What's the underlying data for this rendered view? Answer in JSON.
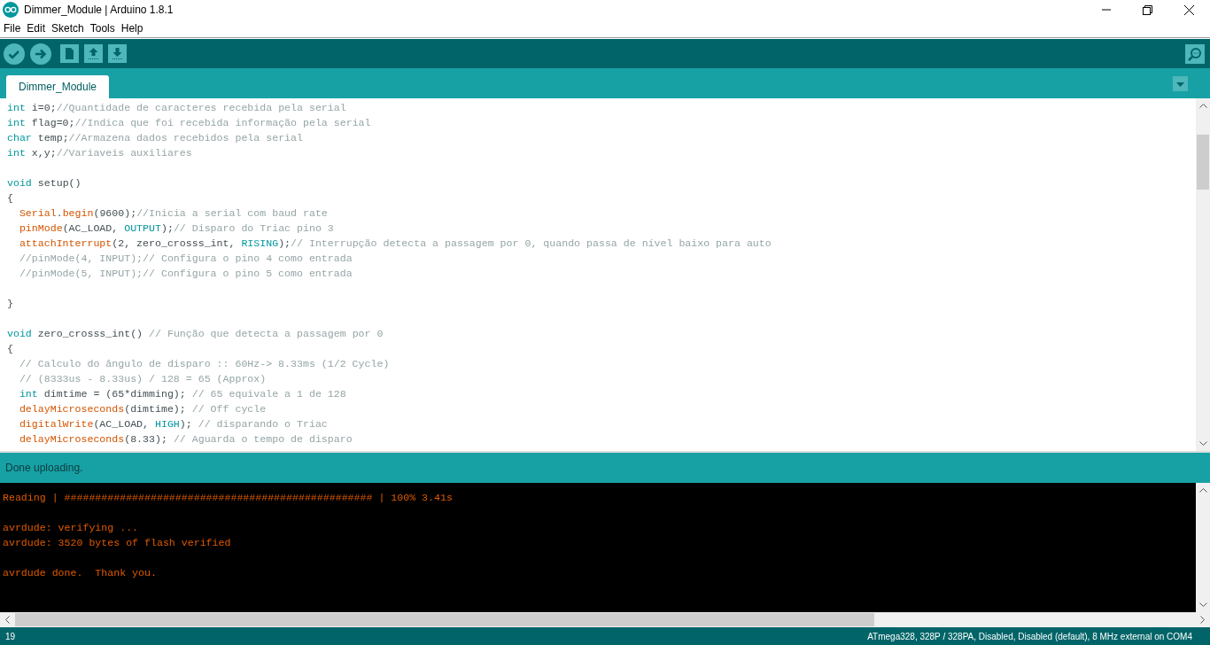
{
  "window": {
    "title": "Dimmer_Module | Arduino 1.8.1"
  },
  "menu": [
    {
      "label": "File"
    },
    {
      "label": "Edit"
    },
    {
      "label": "Sketch"
    },
    {
      "label": "Tools"
    },
    {
      "label": "Help"
    }
  ],
  "tabs": [
    {
      "label": "Dimmer_Module",
      "selected": true
    }
  ],
  "editor": {
    "lines": [
      {
        "kind": "code",
        "tokens": [
          {
            "kind": "keyword",
            "text": "int"
          },
          {
            "kind": "plain",
            "text": " i=0;"
          },
          {
            "kind": "comment",
            "text": "//Quantidade de caracteres recebida pela serial"
          }
        ]
      },
      {
        "kind": "code",
        "tokens": [
          {
            "kind": "keyword",
            "text": "int"
          },
          {
            "kind": "plain",
            "text": " flag=0;"
          },
          {
            "kind": "comment",
            "text": "//Indica que foi recebida informação pela serial"
          }
        ]
      },
      {
        "kind": "code",
        "tokens": [
          {
            "kind": "keyword",
            "text": "char"
          },
          {
            "kind": "plain",
            "text": " temp;"
          },
          {
            "kind": "comment",
            "text": "//Armazena dados recebidos pela serial"
          }
        ]
      },
      {
        "kind": "code",
        "tokens": [
          {
            "kind": "keyword",
            "text": "int"
          },
          {
            "kind": "plain",
            "text": " x,y;"
          },
          {
            "kind": "comment",
            "text": "//Variaveis auxiliares"
          }
        ]
      },
      {
        "kind": "blank"
      },
      {
        "kind": "code",
        "tokens": [
          {
            "kind": "keyword",
            "text": "void"
          },
          {
            "kind": "plain",
            "text": " setup()"
          }
        ]
      },
      {
        "kind": "code",
        "tokens": [
          {
            "kind": "plain",
            "text": "{"
          }
        ]
      },
      {
        "kind": "code",
        "tokens": [
          {
            "kind": "function",
            "text": "  Serial"
          },
          {
            "kind": "plain",
            "text": "."
          },
          {
            "kind": "function",
            "text": "begin"
          },
          {
            "kind": "plain",
            "text": "(9600);"
          },
          {
            "kind": "comment",
            "text": "//Inicia a serial com baud rate"
          }
        ]
      },
      {
        "kind": "code",
        "tokens": [
          {
            "kind": "function",
            "text": "  pinMode"
          },
          {
            "kind": "plain",
            "text": "(AC_LOAD, "
          },
          {
            "kind": "keyword",
            "text": "OUTPUT"
          },
          {
            "kind": "plain",
            "text": ");"
          },
          {
            "kind": "comment",
            "text": "// Disparo do Triac pino 3"
          }
        ]
      },
      {
        "kind": "code",
        "tokens": [
          {
            "kind": "function",
            "text": "  attachInterrupt"
          },
          {
            "kind": "plain",
            "text": "(2, zero_crosss_int, "
          },
          {
            "kind": "keyword",
            "text": "RISING"
          },
          {
            "kind": "plain",
            "text": ");"
          },
          {
            "kind": "comment",
            "text": "// Interrupção detecta a passagem por 0, quando passa de nível baixo para auto"
          }
        ]
      },
      {
        "kind": "code",
        "tokens": [
          {
            "kind": "comment",
            "text": "  //pinMode(4, INPUT);// Configura o pino 4 como entrada"
          }
        ]
      },
      {
        "kind": "code",
        "tokens": [
          {
            "kind": "comment",
            "text": "  //pinMode(5, INPUT);// Configura o pino 5 como entrada"
          }
        ]
      },
      {
        "kind": "blank"
      },
      {
        "kind": "code",
        "tokens": [
          {
            "kind": "plain",
            "text": "}"
          }
        ]
      },
      {
        "kind": "blank"
      },
      {
        "kind": "code",
        "tokens": [
          {
            "kind": "keyword",
            "text": "void"
          },
          {
            "kind": "plain",
            "text": " zero_crosss_int() "
          },
          {
            "kind": "comment",
            "text": "// Função que detecta a passagem por 0"
          }
        ]
      },
      {
        "kind": "code",
        "tokens": [
          {
            "kind": "plain",
            "text": "{"
          }
        ]
      },
      {
        "kind": "code",
        "tokens": [
          {
            "kind": "comment",
            "text": "  // Calculo do ângulo de disparo :: 60Hz-> 8.33ms (1/2 Cycle)"
          }
        ]
      },
      {
        "kind": "code",
        "tokens": [
          {
            "kind": "comment",
            "text": "  // (8333us - 8.33us) / 128 = 65 (Approx)"
          }
        ]
      },
      {
        "kind": "code",
        "tokens": [
          {
            "kind": "keyword",
            "text": "  int"
          },
          {
            "kind": "plain",
            "text": " dimtime = (65*dimming); "
          },
          {
            "kind": "comment",
            "text": "// 65 equivale a 1 de 128"
          }
        ]
      },
      {
        "kind": "code",
        "tokens": [
          {
            "kind": "function",
            "text": "  delayMicroseconds"
          },
          {
            "kind": "plain",
            "text": "(dimtime); "
          },
          {
            "kind": "comment",
            "text": "// Off cycle"
          }
        ]
      },
      {
        "kind": "code",
        "tokens": [
          {
            "kind": "function",
            "text": "  digitalWrite"
          },
          {
            "kind": "plain",
            "text": "(AC_LOAD, "
          },
          {
            "kind": "keyword",
            "text": "HIGH"
          },
          {
            "kind": "plain",
            "text": "); "
          },
          {
            "kind": "comment",
            "text": "// disparando o Triac"
          }
        ]
      },
      {
        "kind": "code",
        "tokens": [
          {
            "kind": "function",
            "text": "  delayMicroseconds"
          },
          {
            "kind": "plain",
            "text": "(8.33); "
          },
          {
            "kind": "comment",
            "text": "// Aguarda o tempo de disparo"
          }
        ]
      }
    ]
  },
  "message": "Done uploading.",
  "console": [
    {
      "kind": "text",
      "text": "Reading | ################################################## | 100% 3.41s"
    },
    {
      "kind": "blank"
    },
    {
      "kind": "text",
      "text": "avrdude: verifying ..."
    },
    {
      "kind": "text",
      "text": "avrdude: 3520 bytes of flash verified"
    },
    {
      "kind": "blank"
    },
    {
      "kind": "text",
      "text": "avrdude done.  Thank you."
    }
  ],
  "status_bar": {
    "line": "19",
    "board": "ATmega328, 328P / 328PA, Disabled, Disabled (default), 8 MHz external on COM4"
  }
}
